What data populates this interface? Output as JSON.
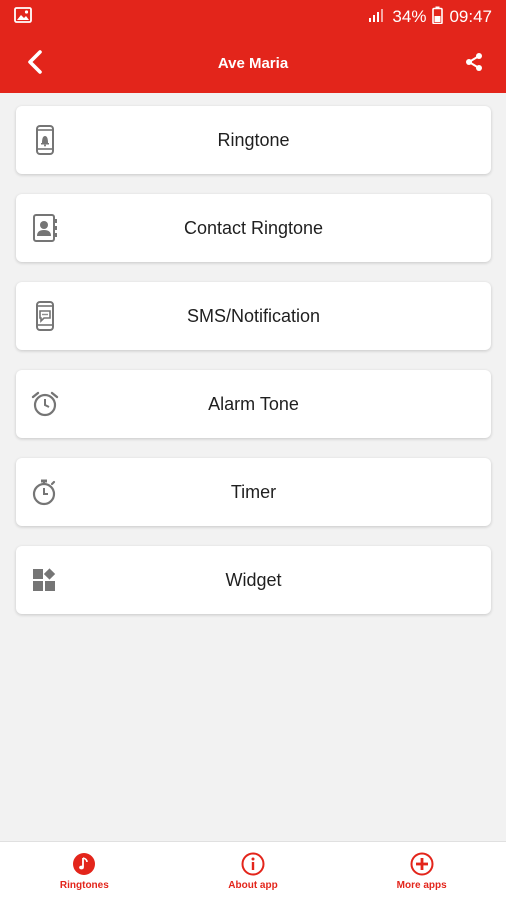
{
  "status": {
    "battery": "34%",
    "time": "09:47"
  },
  "appbar": {
    "title": "Ave Maria"
  },
  "items": [
    {
      "label": "Ringtone",
      "icon": "phone-bell-icon"
    },
    {
      "label": "Contact Ringtone",
      "icon": "contact-book-icon"
    },
    {
      "label": "SMS/Notification",
      "icon": "phone-message-icon"
    },
    {
      "label": "Alarm Tone",
      "icon": "alarm-clock-icon"
    },
    {
      "label": "Timer",
      "icon": "stopwatch-icon"
    },
    {
      "label": "Widget",
      "icon": "widget-icon"
    }
  ],
  "bottom_nav": [
    {
      "label": "Ringtones",
      "icon": "music-note-icon"
    },
    {
      "label": "About app",
      "icon": "info-icon"
    },
    {
      "label": "More apps",
      "icon": "plus-circle-icon"
    }
  ],
  "colors": {
    "primary": "#e3251b",
    "background": "#f2f2f2",
    "icon_gray": "#757575"
  }
}
